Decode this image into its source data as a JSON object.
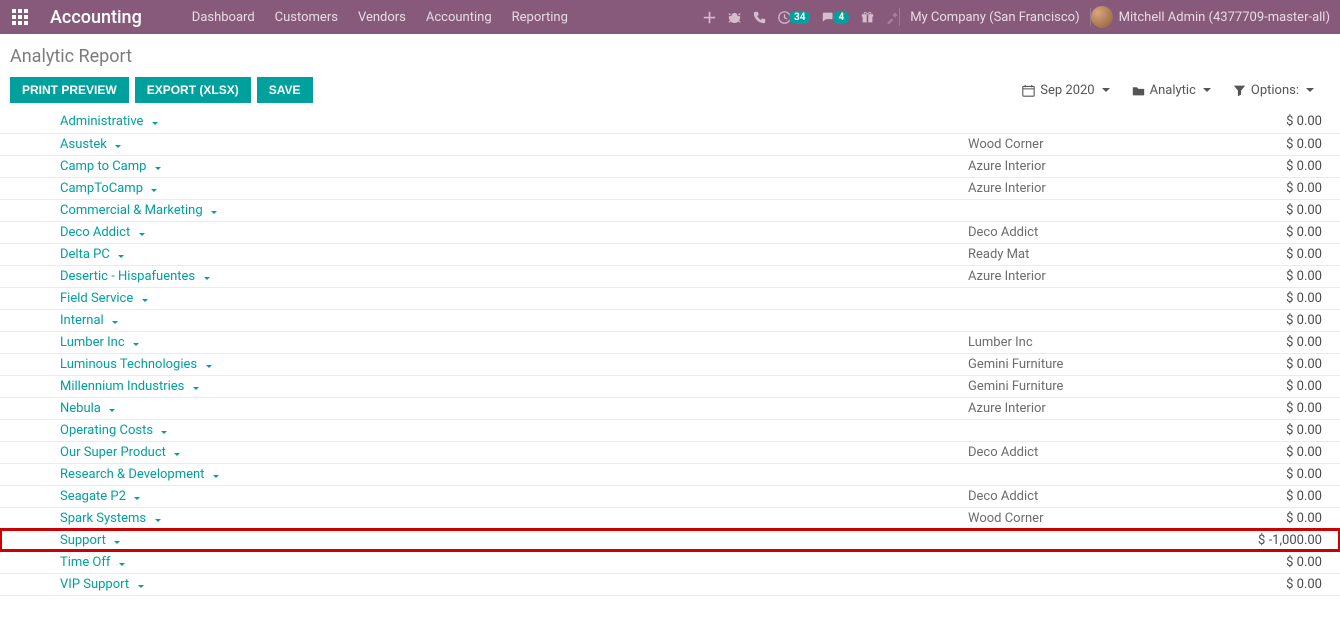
{
  "navbar": {
    "brand": "Accounting",
    "menu": [
      "Dashboard",
      "Customers",
      "Vendors",
      "Accounting",
      "Reporting"
    ],
    "badge_clock": "34",
    "badge_chat": "4",
    "company": "My Company (San Francisco)",
    "user": "Mitchell Admin (4377709-master-all)"
  },
  "breadcrumb": "Analytic Report",
  "buttons": {
    "print": "PRINT PREVIEW",
    "export": "EXPORT (XLSX)",
    "save": "SAVE"
  },
  "filters": {
    "date": "Sep 2020",
    "group": "Analytic",
    "options": "Options:"
  },
  "rows": [
    {
      "name": "Administrative",
      "partner": "",
      "amount": "$ 0.00"
    },
    {
      "name": "Asustek",
      "partner": "Wood Corner",
      "amount": "$ 0.00"
    },
    {
      "name": "Camp to Camp",
      "partner": "Azure Interior",
      "amount": "$ 0.00"
    },
    {
      "name": "CampToCamp",
      "partner": "Azure Interior",
      "amount": "$ 0.00"
    },
    {
      "name": "Commercial & Marketing",
      "partner": "",
      "amount": "$ 0.00"
    },
    {
      "name": "Deco Addict",
      "partner": "Deco Addict",
      "amount": "$ 0.00"
    },
    {
      "name": "Delta PC",
      "partner": "Ready Mat",
      "amount": "$ 0.00"
    },
    {
      "name": "Desertic - Hispafuentes",
      "partner": "Azure Interior",
      "amount": "$ 0.00"
    },
    {
      "name": "Field Service",
      "partner": "",
      "amount": "$ 0.00"
    },
    {
      "name": "Internal",
      "partner": "",
      "amount": "$ 0.00"
    },
    {
      "name": "Lumber Inc",
      "partner": "Lumber Inc",
      "amount": "$ 0.00"
    },
    {
      "name": "Luminous Technologies",
      "partner": "Gemini Furniture",
      "amount": "$ 0.00"
    },
    {
      "name": "Millennium Industries",
      "partner": "Gemini Furniture",
      "amount": "$ 0.00"
    },
    {
      "name": "Nebula",
      "partner": "Azure Interior",
      "amount": "$ 0.00"
    },
    {
      "name": "Operating Costs",
      "partner": "",
      "amount": "$ 0.00"
    },
    {
      "name": "Our Super Product",
      "partner": "Deco Addict",
      "amount": "$ 0.00"
    },
    {
      "name": "Research & Development",
      "partner": "",
      "amount": "$ 0.00"
    },
    {
      "name": "Seagate P2",
      "partner": "Deco Addict",
      "amount": "$ 0.00"
    },
    {
      "name": "Spark Systems",
      "partner": "Wood Corner",
      "amount": "$ 0.00"
    },
    {
      "name": "Support",
      "partner": "",
      "amount": "$ -1,000.00",
      "highlight": true
    },
    {
      "name": "Time Off",
      "partner": "",
      "amount": "$ 0.00"
    },
    {
      "name": "VIP Support",
      "partner": "",
      "amount": "$ 0.00"
    }
  ]
}
